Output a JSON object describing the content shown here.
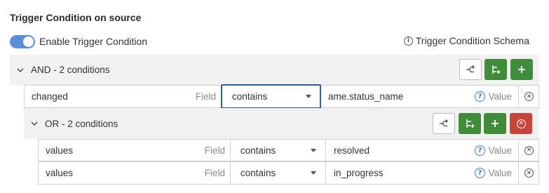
{
  "section": {
    "title": "Trigger Condition on source",
    "toggle_label": "Enable Trigger Condition",
    "toggle_on": true,
    "schema_link": "Trigger Condition Schema"
  },
  "and_group": {
    "label": "AND - 2 conditions",
    "condition": {
      "field_value": "changed",
      "field_hint": "Field",
      "operator": "contains",
      "value": "ame.status_name",
      "value_hint": "Value"
    }
  },
  "or_group": {
    "label": "OR - 2 conditions",
    "conditions": [
      {
        "field_value": "values",
        "field_hint": "Field",
        "operator": "contains",
        "value": "resolved",
        "value_hint": "Value"
      },
      {
        "field_value": "values",
        "field_hint": "Field",
        "operator": "contains",
        "value": "in_progress",
        "value_hint": "Value"
      }
    ]
  },
  "colors": {
    "accent": "#5b8ed8",
    "add_green": "#3f8d3b",
    "delete_red": "#c8453b",
    "group_bg": "#f1f1f1",
    "focus_border": "#2f5f9e"
  }
}
